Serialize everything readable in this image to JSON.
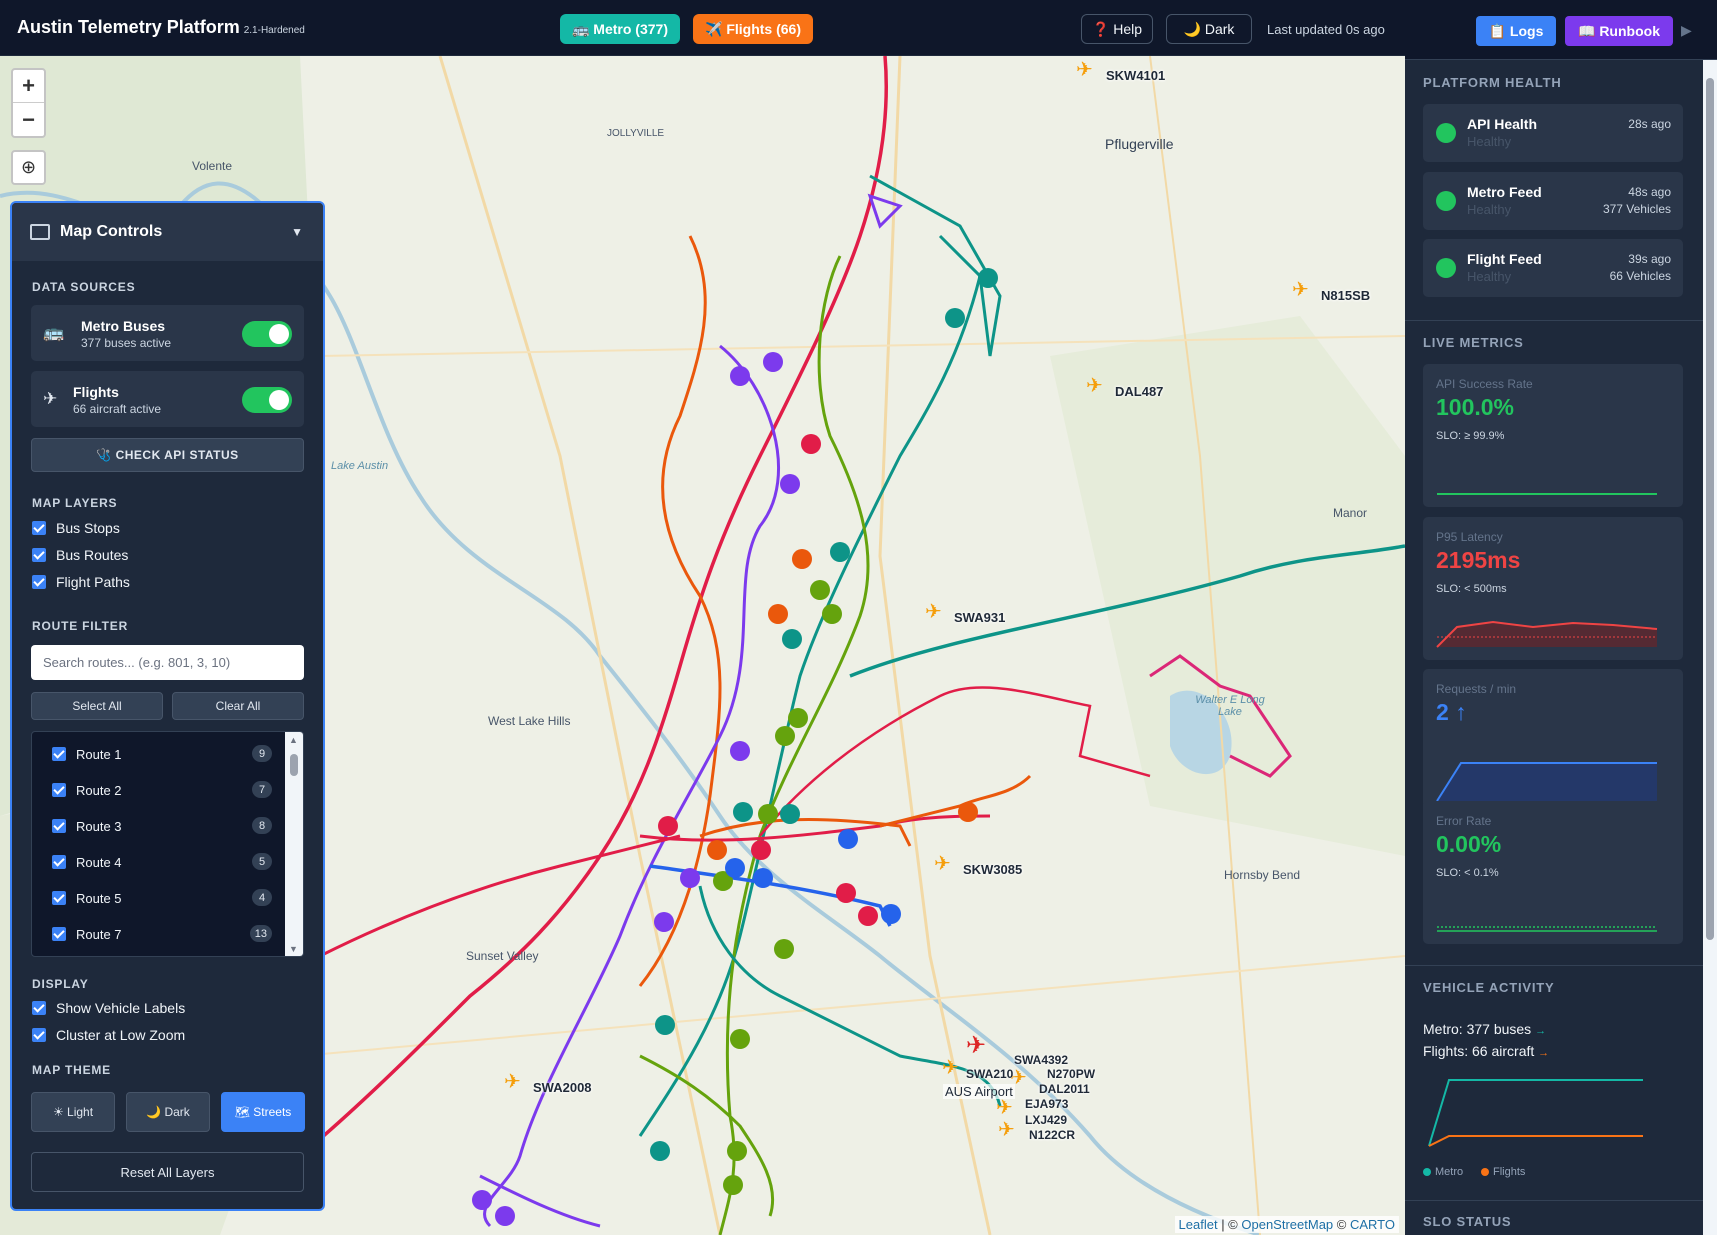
{
  "header": {
    "title": "Austin Telemetry Platform",
    "version": "2.1-Hardened",
    "metro_pill": "🚌 Metro (377)",
    "flights_pill": "✈️ Flights (66)",
    "help_label": "❓ Help",
    "dark_label": "🌙 Dark",
    "last_updated": "Last updated 0s ago"
  },
  "map": {
    "zoom_in": "+",
    "zoom_out": "−",
    "locate": "⊕",
    "places": {
      "volente": "Volente",
      "jollyville": "JOLLYVILLE",
      "pflugerville": "Pflugerville",
      "lake_austin": "Lake Austin",
      "west_lake_hills": "West Lake Hills",
      "sunset_valley": "Sunset Valley",
      "manor": "Manor",
      "walter_long": "Walter E Long Lake",
      "hornsby_bend": "Hornsby Bend",
      "aus_airport": "AUS Airport"
    },
    "flights": {
      "skw4101": "SKW4101",
      "n815sb": "N815SB",
      "dal487": "DAL487",
      "swa931": "SWA931",
      "skw3085": "SKW3085",
      "swa2008": "SWA2008",
      "swa4392": "SWA4392",
      "swa210": "SWA210",
      "n270pw": "N270PW",
      "dal2011": "DAL2011",
      "eja973": "EJA973",
      "lxj429": "LXJ429",
      "n122cr": "N122CR"
    },
    "attribution": {
      "leaflet": "Leaflet",
      "sep1": " | © ",
      "osm": "OpenStreetMap",
      "sep2": " © ",
      "carto": "CARTO"
    }
  },
  "controls": {
    "title": "Map Controls",
    "caret": "▼",
    "data_sources_title": "DATA SOURCES",
    "metro": {
      "icon": "🚌",
      "label": "Metro Buses",
      "sub": "377 buses active"
    },
    "flights": {
      "icon": "✈",
      "label": "Flights",
      "sub": "66 aircraft active"
    },
    "check_api": "🩺 CHECK API STATUS",
    "map_layers_title": "MAP LAYERS",
    "layers": [
      "Bus Stops",
      "Bus Routes",
      "Flight Paths"
    ],
    "route_filter_title": "ROUTE FILTER",
    "search_placeholder": "Search routes... (e.g. 801, 3, 10)",
    "select_all": "Select All",
    "clear_all": "Clear All",
    "routes": [
      {
        "label": "Route 1",
        "count": "9"
      },
      {
        "label": "Route 2",
        "count": "7"
      },
      {
        "label": "Route 3",
        "count": "8"
      },
      {
        "label": "Route 4",
        "count": "5"
      },
      {
        "label": "Route 5",
        "count": "4"
      },
      {
        "label": "Route 7",
        "count": "13"
      }
    ],
    "display_title": "DISPLAY",
    "display": [
      "Show Vehicle Labels",
      "Cluster at Low Zoom"
    ],
    "map_theme_title": "MAP THEME",
    "themes": {
      "light": "☀ Light",
      "dark": "🌙 Dark",
      "streets": "🗺 Streets"
    },
    "reset": "Reset All Layers"
  },
  "sidebar": {
    "logs": "📋 Logs",
    "runbook": "📖 Runbook",
    "arrow": "▶",
    "platform_health_title": "PLATFORM HEALTH",
    "health": [
      {
        "name": "API Health",
        "status": "Healthy",
        "time": "28s ago",
        "extra": ""
      },
      {
        "name": "Metro Feed",
        "status": "Healthy",
        "time": "48s ago",
        "extra": "377 Vehicles"
      },
      {
        "name": "Flight Feed",
        "status": "Healthy",
        "time": "39s ago",
        "extra": "66 Vehicles"
      }
    ],
    "live_metrics_title": "LIVE METRICS",
    "metrics": [
      {
        "label": "API Success Rate",
        "value": "100.0%",
        "slo": "SLO: ≥ 99.9%",
        "color": "#22c55e"
      },
      {
        "label": "P95 Latency",
        "value": "2195ms",
        "slo": "SLO: < 500ms",
        "color": "#ef4444"
      },
      {
        "label": "Requests / min",
        "value": "2 ↑",
        "slo": "",
        "color": "#3b82f6"
      },
      {
        "label": "Error Rate",
        "value": "0.00%",
        "slo": "SLO: < 0.1%",
        "color": "#22c55e"
      }
    ],
    "vehicle_activity_title": "VEHICLE ACTIVITY",
    "metro_activity": "Metro: 377 buses",
    "metro_trend": "→",
    "flights_activity": "Flights: 66 aircraft",
    "flights_trend": "→",
    "legend_metro": "Metro",
    "legend_flights": "Flights",
    "slo_status_title": "SLO STATUS"
  },
  "colors": {
    "metro": "#14b8a6",
    "flights": "#f97316",
    "accent": "#3b82f6",
    "healthy": "#22c55e",
    "bad": "#ef4444"
  }
}
